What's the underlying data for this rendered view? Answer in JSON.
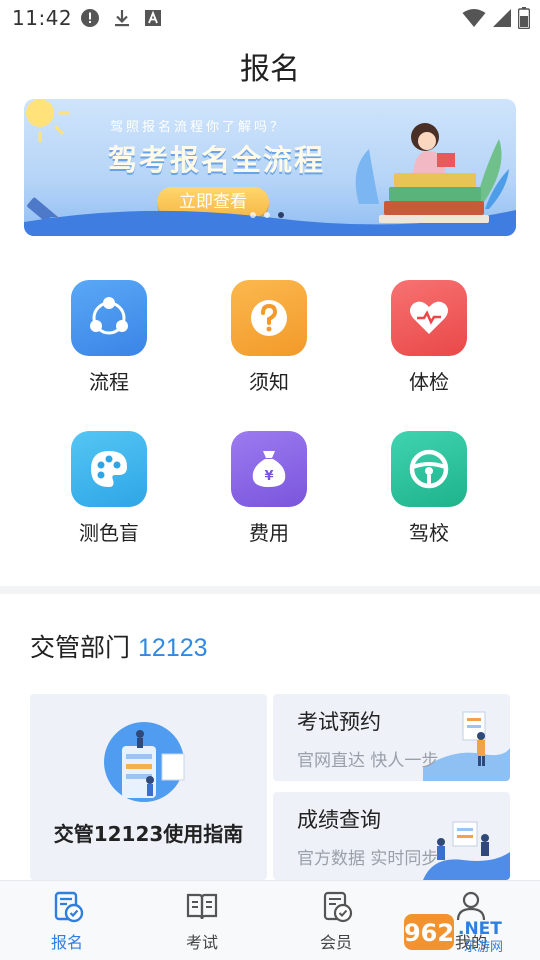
{
  "status_bar": {
    "time": "11:42",
    "left_icons": [
      "alert-icon",
      "download-icon",
      "font-icon"
    ],
    "right_icons": [
      "wifi-icon",
      "signal-icon",
      "battery-icon"
    ]
  },
  "page": {
    "title": "报名"
  },
  "banner": {
    "subtitle": "驾照报名流程你了解吗？",
    "title": "驾考报名全流程",
    "button_label": "立即查看",
    "slide_count": 3,
    "active_slide": 3
  },
  "grid": {
    "items": [
      {
        "label": "流程",
        "icon": "share-nodes-icon",
        "color": "#4a95ef"
      },
      {
        "label": "须知",
        "icon": "question-icon",
        "color": "#f5a134"
      },
      {
        "label": "体检",
        "icon": "heart-pulse-icon",
        "color": "#ef5a5a"
      },
      {
        "label": "测色盲",
        "icon": "palette-icon",
        "color": "#3fb3ec"
      },
      {
        "label": "费用",
        "icon": "money-bag-icon",
        "color": "#8b67e6"
      },
      {
        "label": "驾校",
        "icon": "steering-wheel-icon",
        "color": "#2fc6a0"
      }
    ]
  },
  "section": {
    "title": "交管部门",
    "number": "12123"
  },
  "cards": {
    "guide": {
      "label": "交管12123使用指南"
    },
    "exam_booking": {
      "title": "考试预约",
      "subtitle": "官网直达 快人一步"
    },
    "score_query": {
      "title": "成绩查询",
      "subtitle": "官方数据 实时同步"
    }
  },
  "tabbar": {
    "items": [
      {
        "label": "报名",
        "icon": "register-icon",
        "active": true
      },
      {
        "label": "考试",
        "icon": "book-icon",
        "active": false
      },
      {
        "label": "会员",
        "icon": "member-icon",
        "active": false
      },
      {
        "label": "我的",
        "icon": "user-icon",
        "active": false
      }
    ]
  },
  "watermark": {
    "text": "962.NET",
    "sub": "乐游网"
  }
}
